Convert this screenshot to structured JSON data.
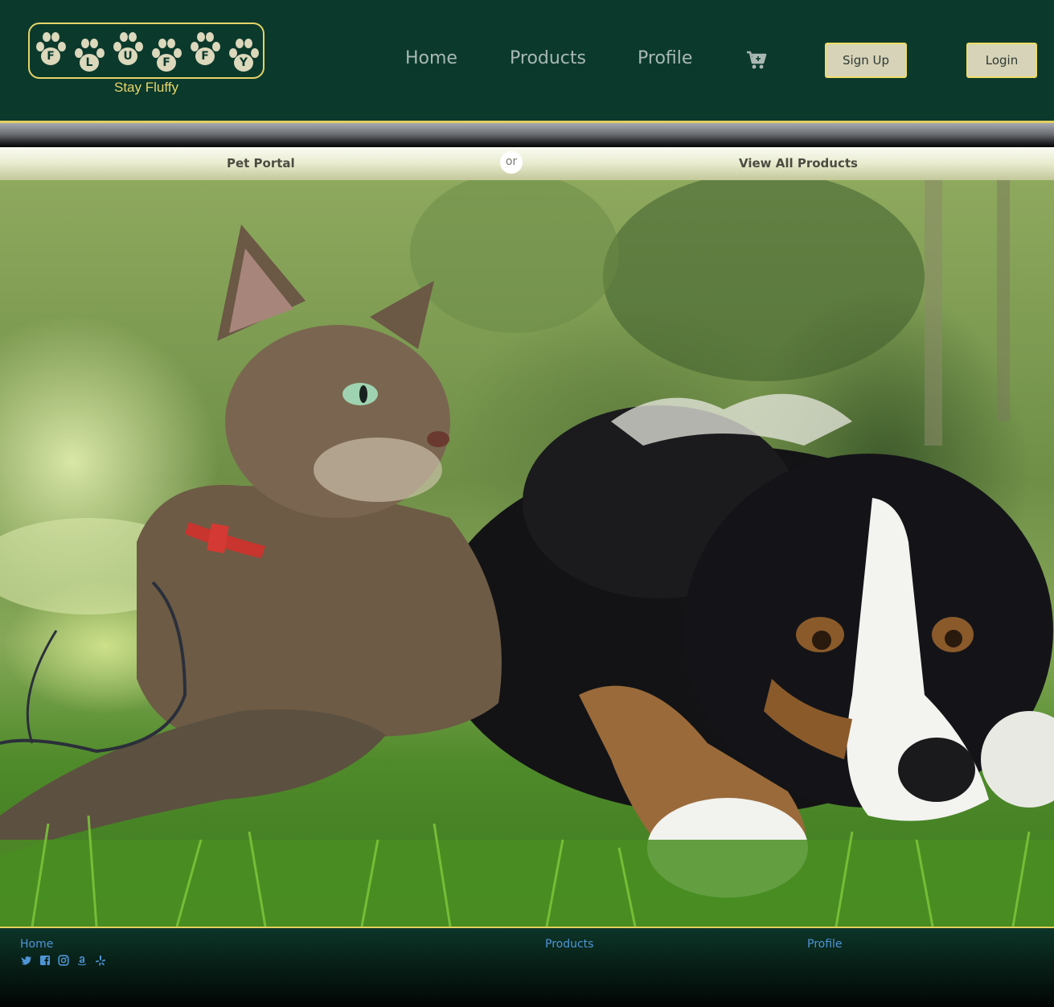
{
  "header": {
    "logo_letters": [
      "F",
      "L",
      "U",
      "F",
      "F",
      "Y"
    ],
    "tagline": "Stay Fluffy",
    "nav": [
      "Home",
      "Products",
      "Profile"
    ],
    "cart_icon": "cart-icon",
    "signup_label": "Sign Up",
    "login_label": "Login"
  },
  "cta": {
    "left_label": "Pet Portal",
    "separator": "or",
    "right_label": "View All Products"
  },
  "hero": {
    "subject": "cat-and-dog-photo"
  },
  "footer": {
    "links": [
      "Home",
      "Products",
      "Profile"
    ],
    "social_icons": [
      "twitter-icon",
      "facebook-icon",
      "instagram-icon",
      "amazon-icon",
      "yelp-icon"
    ]
  },
  "colors": {
    "header_bg": "#0b3a2c",
    "accent_gold": "#e3cf5d",
    "nav_text": "#a9b8b3",
    "button_bg": "#d7d3b8",
    "footer_link": "#4f95d6"
  }
}
